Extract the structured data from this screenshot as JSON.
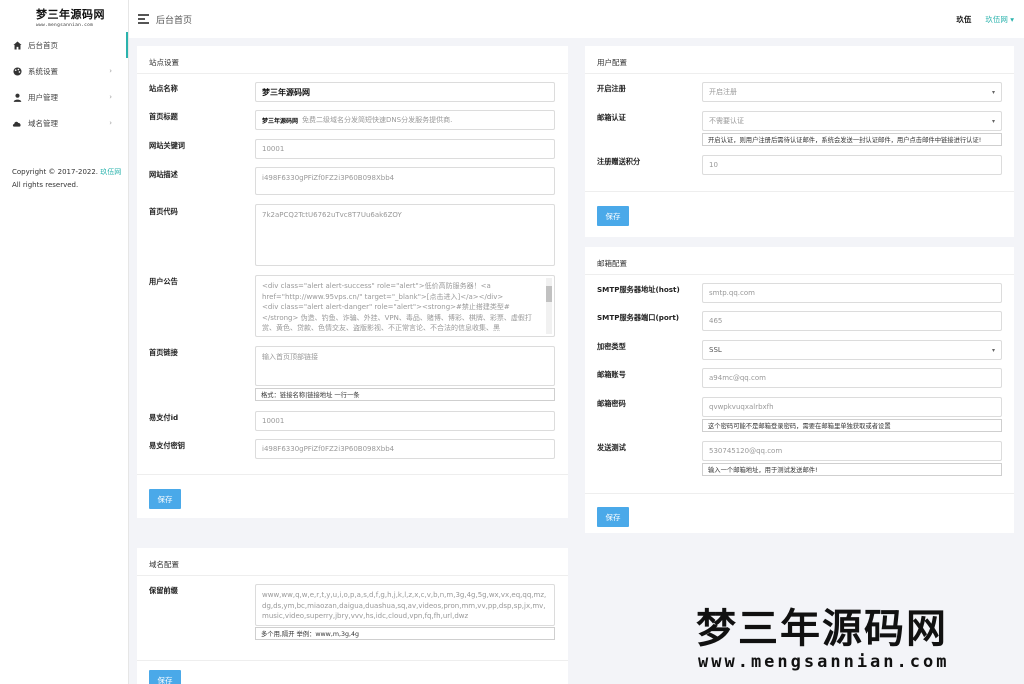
{
  "brand": {
    "logo_main": "梦三年源码网",
    "logo_sub": "www.mengsannian.com"
  },
  "sidebar": {
    "items": [
      {
        "label": "后台首页",
        "icon": "home-icon"
      },
      {
        "label": "系统设置",
        "icon": "palette-icon"
      },
      {
        "label": "用户管理",
        "icon": "user-icon"
      },
      {
        "label": "域名管理",
        "icon": "cloud-icon"
      }
    ],
    "copyright_prefix": "Copyright © 2017-2022.",
    "copyright_link": "玖伍网",
    "copyright_suffix": "All rights reserved."
  },
  "topbar": {
    "title": "后台首页",
    "link1": "玖伍",
    "link2": "玖伍网"
  },
  "site_settings": {
    "header": "站点设置",
    "site_name_label": "站点名称",
    "site_name_value": "梦三年源码网",
    "home_title_label": "首页标题",
    "home_title_value": "免费二级域名分发简短快速DNS分发服务提供商.",
    "keywords_label": "网站关键词",
    "keywords_value": "10001",
    "description_label": "网站描述",
    "description_value": "i498F6330gPFiZf0FZ2i3P60B098Xbb4",
    "home_code_label": "首页代码",
    "home_code_value": "7k2aPCQ2TctU6762uTvc8T7Uu6ak6ZOY",
    "notice_label": "用户公告",
    "notice_value": "<div class=\"alert alert-success\" role=\"alert\">低价高防服务器！<a href=\"http://www.95vps.cn/\" target=\"_blank\">[点击进入]</a></div>\n<div class=\"alert alert-danger\" role=\"alert\"><strong>#禁止搭建类型#</strong> 伪造、钓鱼、诈骗、外挂、VPN、毒品、赌博、博彩、棋牌、彩票、虚假打赏、黄色、贷款、色情交友、盗版影视、不正常言论、不合法的信息收集、黑",
    "home_links_label": "首页链接",
    "home_links_placeholder": "输入首页顶部链接",
    "home_links_hint": "格式：链接名称|链接地址 一行一条",
    "pay_id_label": "易支付id",
    "pay_id_value": "10001",
    "pay_key_label": "易支付密钥",
    "pay_key_value": "i498F6330gPFiZf0FZ2i3P60B098Xbb4",
    "save_label": "保存"
  },
  "domain_settings": {
    "header": "域名配置",
    "reserved_label": "保留前缀",
    "reserved_value": "www,ww,q,w,e,r,t,y,u,i,o,p,a,s,d,f,g,h,j,k,l,z,x,c,v,b,n,m,3g,4g,5g,wx,vx,eq,qq,mz,dg,ds,ym,bc,miaozan,daigua,duashua,sq,av,videos,pron,mm,vv,pp,dsp,sp,jx,mv,music,video,superry,jbry,vvv,hs,idc,cloud,vpn,fq,fh,url,dwz",
    "reserved_hint": "多个用,隔开 举例：www,m,3g,4g",
    "save_label": "保存"
  },
  "user_settings": {
    "header": "用户配置",
    "register_label": "开启注册",
    "register_value": "开启注册",
    "email_verify_label": "邮箱认证",
    "email_verify_value": "不需要认证",
    "email_verify_hint": "开启认证，则用户注册后需待认证邮件，系统会发送一封认证邮件，用户点击邮件中链接进行认证!",
    "points_label": "注册赠送积分",
    "points_value": "10",
    "save_label": "保存"
  },
  "mail_settings": {
    "header": "邮箱配置",
    "host_label": "SMTP服务器地址(host)",
    "host_value": "smtp.qq.com",
    "port_label": "SMTP服务器端口(port)",
    "port_value": "465",
    "encrypt_label": "加密类型",
    "encrypt_value": "SSL",
    "account_label": "邮箱账号",
    "account_value": "a94mc@qq.com",
    "password_label": "邮箱密码",
    "password_value": "qvwpkvuqxalrbxfh",
    "password_hint": "这个密码可能不是邮箱登录密码，需要在邮箱里单独获取或者设置",
    "test_label": "发送测试",
    "test_value": "530745120@qq.com",
    "test_hint": "输入一个邮箱地址，用于测试发送邮件!",
    "save_label": "保存"
  },
  "watermark": {
    "main": "梦三年源码网",
    "sub": "www.mengsannian.com"
  }
}
